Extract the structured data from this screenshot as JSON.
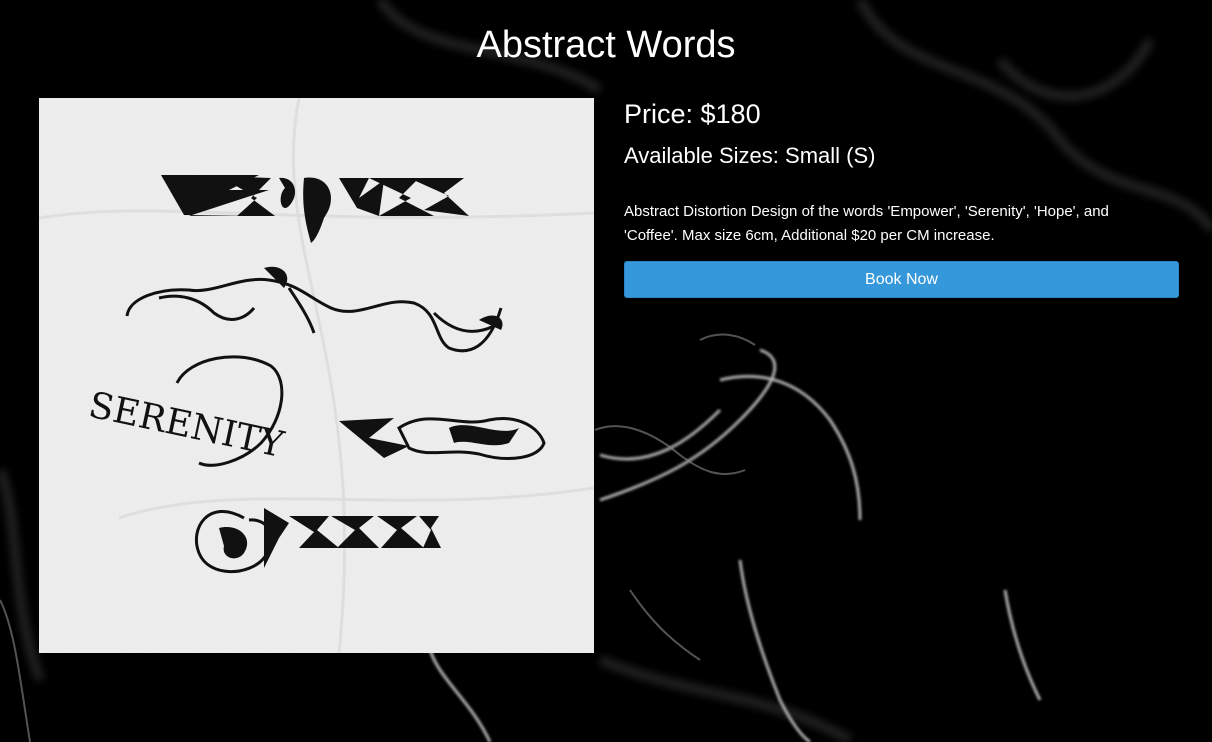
{
  "product": {
    "title": "Abstract Words",
    "price": "Price: $180",
    "sizes": "Available Sizes: Small (S)",
    "description": "Abstract Distortion Design of the words 'Empower', 'Serenity', 'Hope', and 'Coffee'. Max size 6cm, Additional $20 per CM increase.",
    "book_label": "Book Now",
    "image_words": [
      "SERENITY"
    ]
  },
  "colors": {
    "background": "#000000",
    "button": "#3498db",
    "text": "#ffffff",
    "paper": "#eeeeee"
  }
}
